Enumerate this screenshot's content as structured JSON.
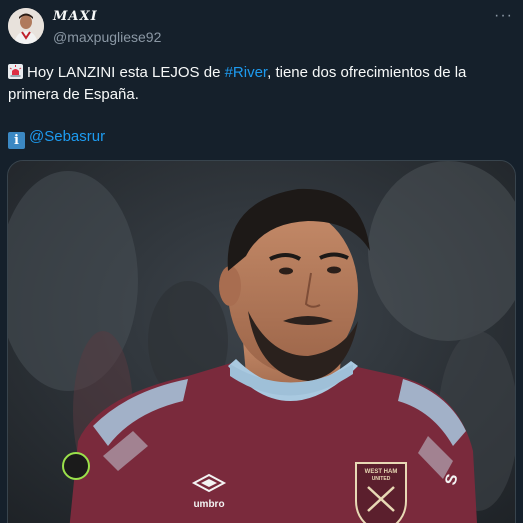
{
  "author": {
    "name": "MAXI",
    "handle": "@maxpugliese92"
  },
  "tweet": {
    "text_before": "Hoy LANZINI esta LEJOS de ",
    "hashtag": "#River",
    "text_after": ", tiene dos ofrecimientos de la primera de España.",
    "mention": "@Sebasrur"
  },
  "media": {
    "crest_line1": "WEST HAM",
    "crest_line2": "UNITED",
    "sponsor_label": "umbro"
  },
  "icons": {
    "siren": "police-light-icon",
    "info": "information-icon",
    "more": "more-options-icon"
  },
  "colors": {
    "background": "#15202b",
    "link": "#1d9bf0",
    "muted": "#8b98a5",
    "jersey": "#7a2a3c"
  }
}
